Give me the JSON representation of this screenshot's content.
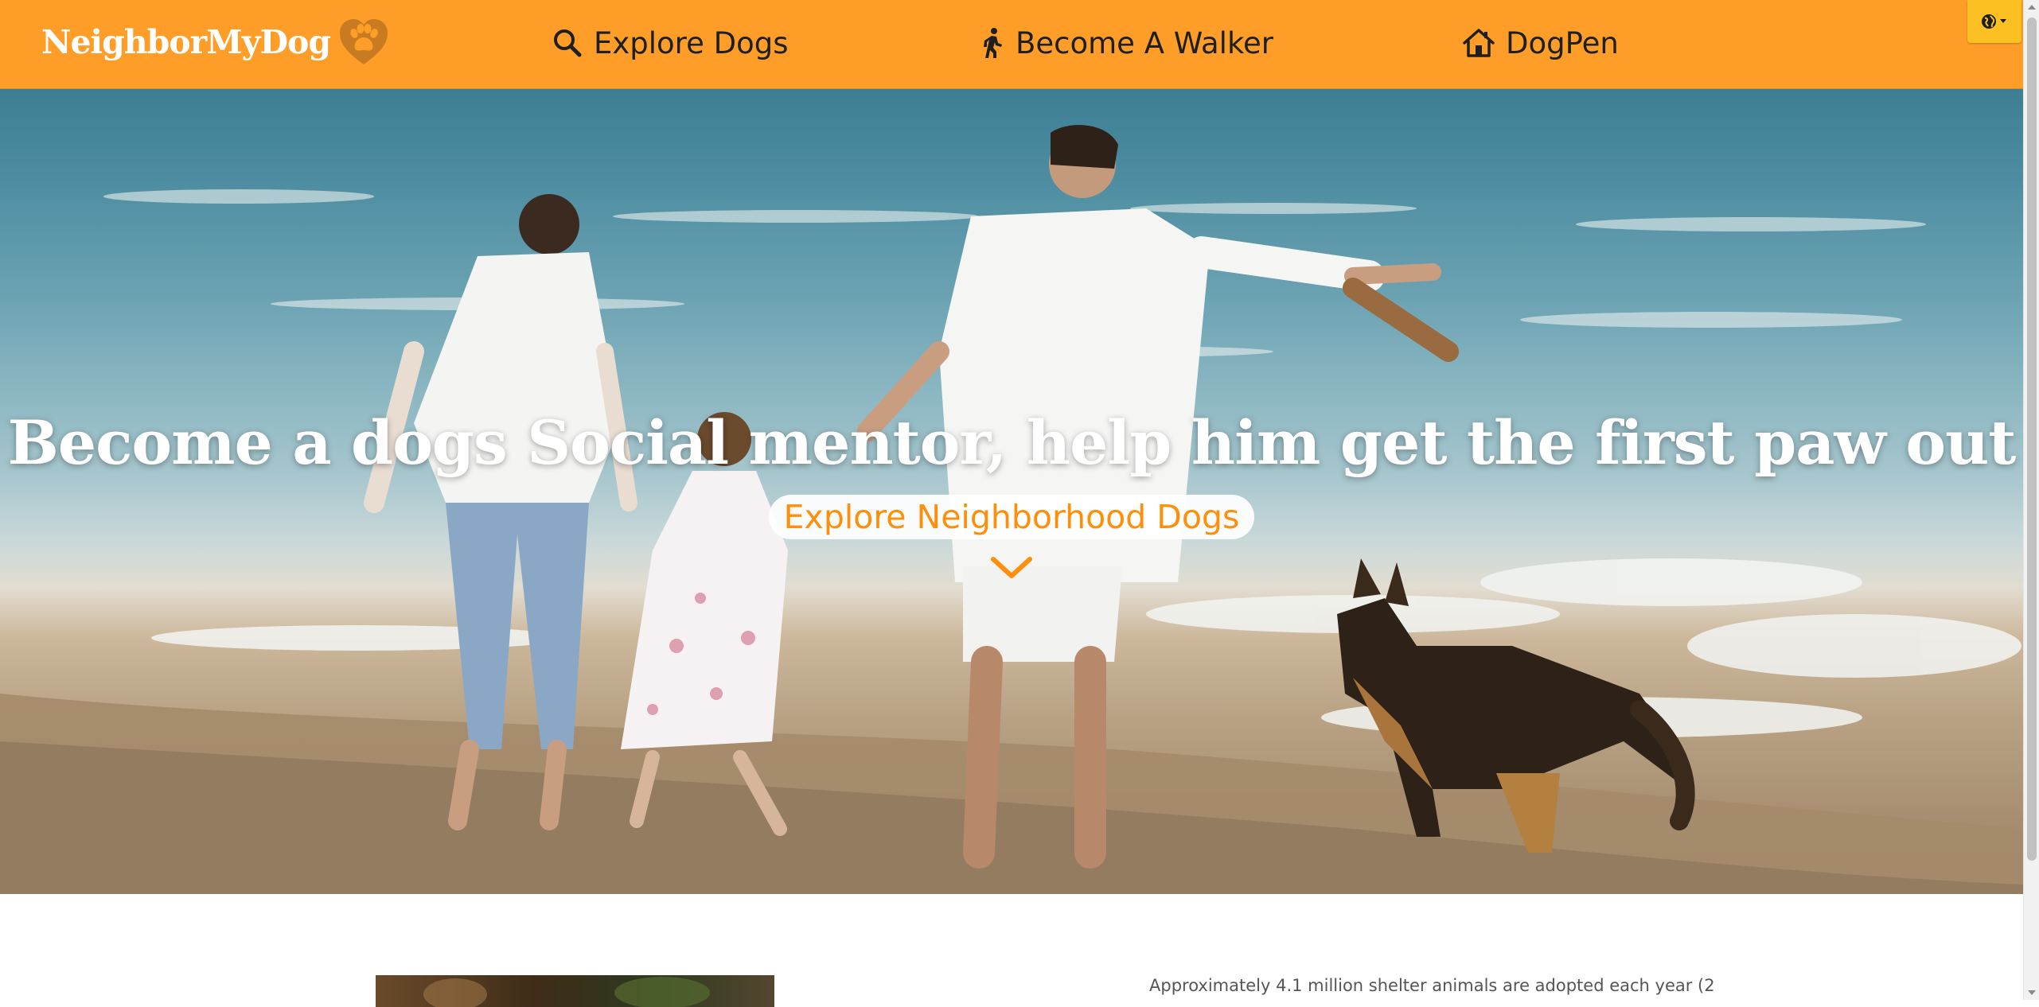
{
  "navbar": {
    "brand": "NeighborMyDog",
    "brand_color": "#fe9e28",
    "items": [
      {
        "label": "Explore Dogs",
        "icon": "search-icon"
      },
      {
        "label": "Become A Walker",
        "icon": "walking-person-icon"
      },
      {
        "label": "DogPen",
        "icon": "house-icon"
      }
    ],
    "language_icon": "globe-icon"
  },
  "hero": {
    "title": "Become a dogs Social mentor, help him get the first paw out",
    "cta_label": "Explore Neighborhood Dogs",
    "cta_color": "#ff8f0b",
    "scroll_icon": "chevron-down-icon"
  },
  "content": {
    "paragraph_start": "Approximately 4.1 million shelter animals are adopted each year (2"
  }
}
